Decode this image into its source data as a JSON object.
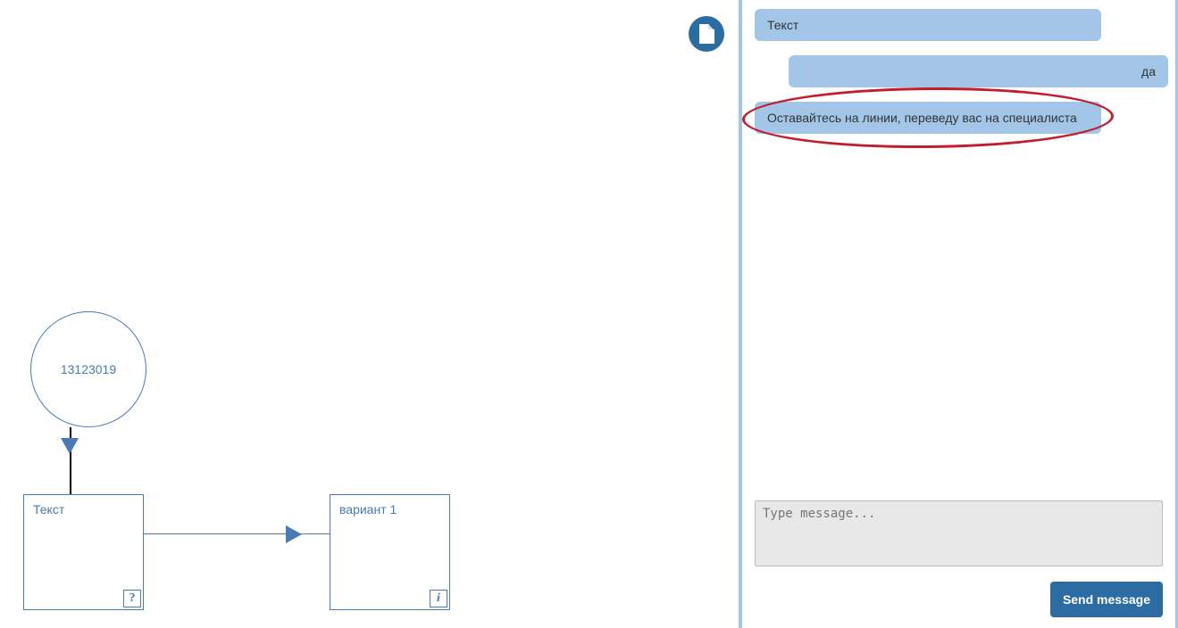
{
  "canvas": {
    "circle_node": {
      "label": "13123019"
    },
    "box1": {
      "label": "Текст",
      "icon": "?"
    },
    "box2": {
      "label": "вариант 1",
      "icon": "i"
    }
  },
  "chat": {
    "messages": [
      {
        "role": "bot",
        "text": "Текст"
      },
      {
        "role": "user",
        "text": "да"
      },
      {
        "role": "bot",
        "text": "Оставайтесь на линии, переведу вас на специалиста",
        "highlighted": true
      }
    ],
    "input_placeholder": "Type message...",
    "send_label": "Send message"
  }
}
